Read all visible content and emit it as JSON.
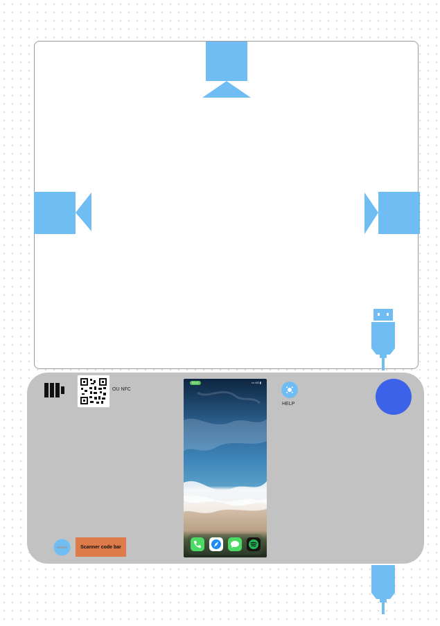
{
  "kiosk": {
    "qr_label": "OU NFC",
    "help_label": "HELP",
    "scan_button_label": "Scanner code bar"
  },
  "phone": {
    "status_time": "09:41",
    "status_right": "••• 4G ▮",
    "dock_apps": [
      "phone-app",
      "safari-app",
      "messages-app",
      "spotify-app"
    ]
  },
  "colors": {
    "camera_blue": "#6fbdf2",
    "kiosk_gray": "#c2c2c2",
    "accent_blue": "#3d62ea",
    "scan_orange": "#de7b4a"
  },
  "icons": [
    "camera-top-icon",
    "camera-left-icon",
    "camera-right-icon",
    "usb-plug-top-icon",
    "usb-plug-bottom-icon",
    "battery-icon",
    "qr-code-icon",
    "help-icon",
    "minus-icon"
  ]
}
